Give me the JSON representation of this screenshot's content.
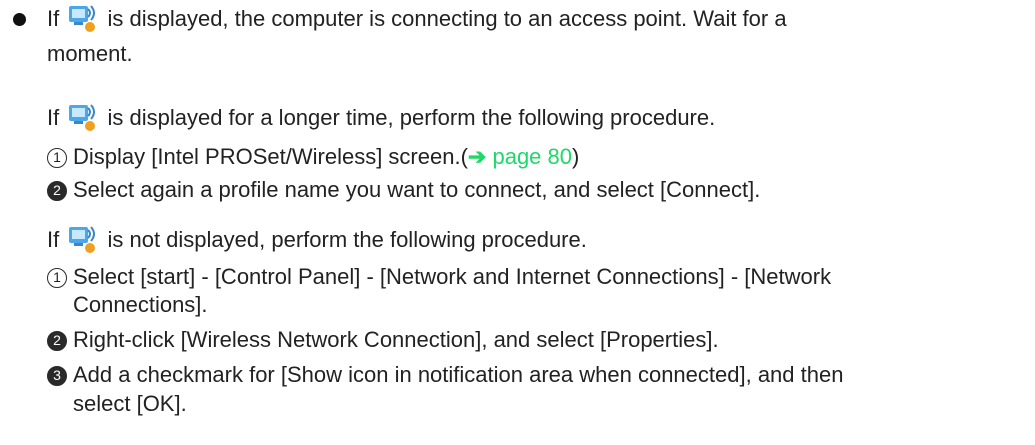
{
  "bullet": {
    "text_if": "If",
    "text_after_icon": "is displayed, the computer is connecting to an access point.  Wait for a",
    "text_cont": "moment."
  },
  "section1": {
    "text_if": "If",
    "text_after_icon": "is displayed for a longer time, perform the following procedure.",
    "steps": [
      {
        "num": "1",
        "text": "Display [Intel PROSet/Wireless] screen.(",
        "arrow": "➔",
        "link": "page 80",
        "close": ")"
      },
      {
        "num": "2",
        "text": "Select again a profile name you want to connect, and select [Connect]."
      }
    ]
  },
  "section2": {
    "text_if": "If",
    "text_after_icon": "is not displayed, perform the following procedure.",
    "steps": [
      {
        "num": "1",
        "text": "Select [start] - [Control Panel] - [Network and Internet Connections] - [Network",
        "text_cont": "Connections]."
      },
      {
        "num": "2",
        "text": "Right-click [Wireless Network Connection], and select [Properties]."
      },
      {
        "num": "3",
        "text": "Add a checkmark for [Show icon in notification area when connected], and then",
        "text_cont": "select [OK]."
      }
    ]
  },
  "icon": "wireless-connecting-icon",
  "colors": {
    "link": "#1fd86a",
    "text": "#222222",
    "icon_blue": "#4aa8e8",
    "icon_badge": "#f0a020"
  }
}
